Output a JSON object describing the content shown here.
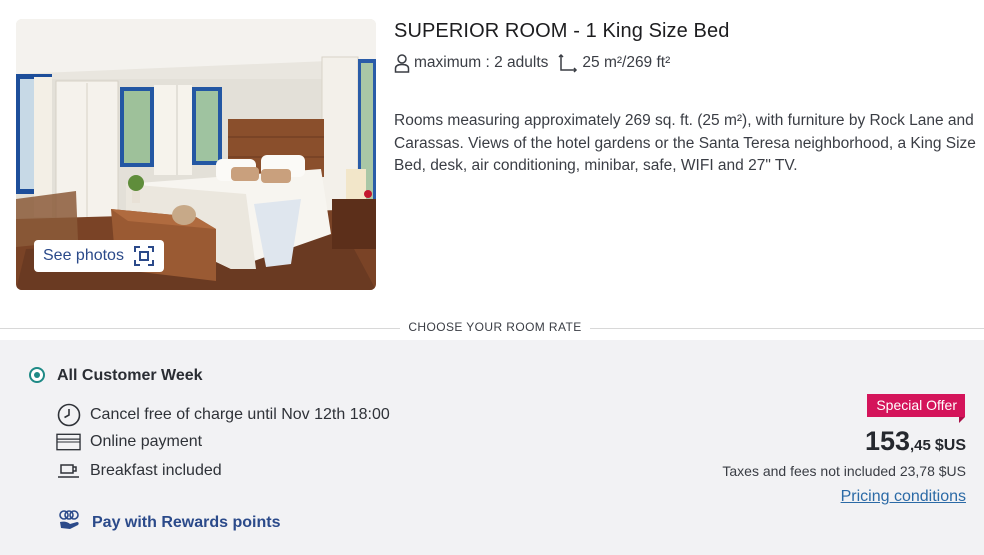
{
  "room": {
    "title": "SUPERIOR ROOM - 1 King Size Bed",
    "capacity": "maximum : 2 adults",
    "area": "25 m²/269 ft²",
    "description": "Rooms measuring approximately 269 sq. ft. (25 m²), with furniture by Rock Lane and Carassas. Views of the hotel gardens or the Santa Teresa neighborhood, a King Size Bed, desk, air conditioning, minibar, safe, WIFI and 27\" TV.",
    "see_photos_label": "See photos",
    "icons": {
      "capacity": "person-icon",
      "area": "area-corner-icon",
      "see_photos": "gallery-frame-icon"
    }
  },
  "section_label": "CHOOSE YOUR ROOM RATE",
  "rate": {
    "name": "All Customer Week",
    "selected": true,
    "features": [
      {
        "icon": "clock-icon",
        "label": "Cancel free of charge until Nov 12th 18:00"
      },
      {
        "icon": "credit-card-icon",
        "label": "Online payment"
      },
      {
        "icon": "coffee-cup-icon",
        "label": "Breakfast included"
      }
    ],
    "rewards_label": "Pay with Rewards points",
    "offer_badge": "Special Offer",
    "price_integer": "153",
    "price_decimal": ",45",
    "currency": "$US",
    "taxes_note": "Taxes and fees not included 23,78 $US",
    "pricing_link": "Pricing conditions"
  },
  "colors": {
    "accent_teal": "#1f8a86",
    "offer_red": "#d4145a",
    "link_blue": "#2b6aa6",
    "panel_bg": "#f2f2f4"
  }
}
